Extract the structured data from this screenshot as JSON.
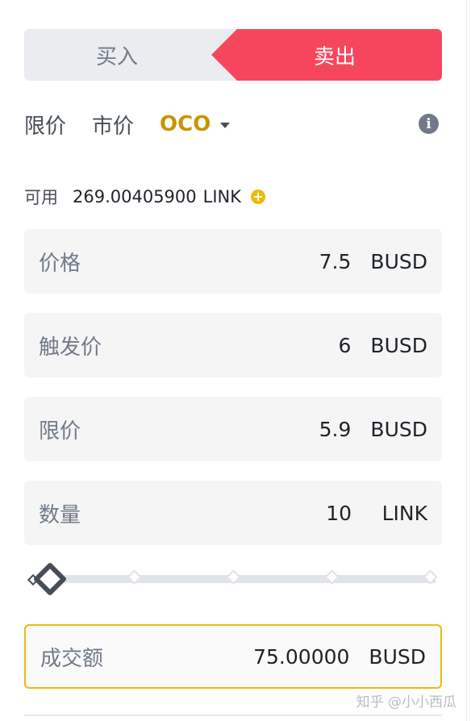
{
  "side_toggle": {
    "buy_label": "买入",
    "sell_label": "卖出",
    "active": "sell"
  },
  "order_types": {
    "limit": "限价",
    "market": "市价",
    "oco": "OCO",
    "active": "oco"
  },
  "info_icon": "i",
  "available": {
    "label": "可用",
    "value": "269.00405900",
    "unit": "LINK"
  },
  "fields": {
    "price": {
      "label": "价格",
      "value": "7.5",
      "unit": "BUSD"
    },
    "trigger": {
      "label": "触发价",
      "value": "6",
      "unit": "BUSD"
    },
    "limit": {
      "label": "限价",
      "value": "5.9",
      "unit": "BUSD"
    },
    "amount": {
      "label": "数量",
      "value": "10",
      "unit": "LINK"
    }
  },
  "slider": {
    "percent": 0,
    "stops": [
      0,
      25,
      50,
      75,
      100
    ]
  },
  "total": {
    "label": "成交额",
    "value": "75.00000",
    "unit": "BUSD"
  },
  "watermark": "知乎 @小小西瓜",
  "colors": {
    "sell": "#f6465d",
    "accent": "#f0b90b",
    "oco_text": "#c99400",
    "field_bg": "#f5f5f5"
  },
  "icons": {
    "info": "info-icon",
    "plus": "plus-circle-icon",
    "dropdown": "caret-down-icon",
    "slider_handle": "diamond-handle"
  }
}
